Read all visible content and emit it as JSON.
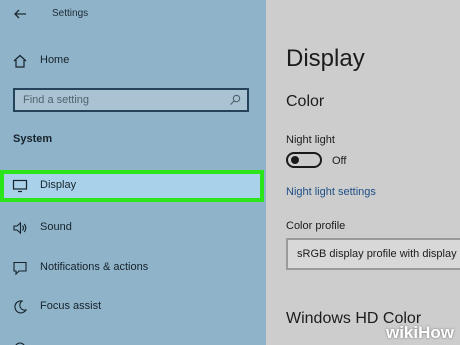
{
  "window": {
    "title": "Settings"
  },
  "sidebar": {
    "home_label": "Home",
    "search_placeholder": "Find a setting",
    "section_title": "System",
    "items": [
      {
        "label": "Display",
        "icon": "monitor-icon",
        "selected": true
      },
      {
        "label": "Sound",
        "icon": "speaker-icon"
      },
      {
        "label": "Notifications & actions",
        "icon": "notification-icon"
      },
      {
        "label": "Focus assist",
        "icon": "moon-icon"
      }
    ]
  },
  "main": {
    "title": "Display",
    "color_heading": "Color",
    "night_light_label": "Night light",
    "night_light_state": "Off",
    "night_light_link": "Night light settings",
    "color_profile_label": "Color profile",
    "color_profile_value": "sRGB display profile with display",
    "hd_color_heading": "Windows HD Color"
  },
  "watermark": {
    "part1": "wiki",
    "part2": "How"
  },
  "colors": {
    "sidebar_bg": "#8fb3c9",
    "highlight_border": "#2be51a",
    "highlight_fill": "#a9d2ea",
    "link": "#1d4f86"
  }
}
